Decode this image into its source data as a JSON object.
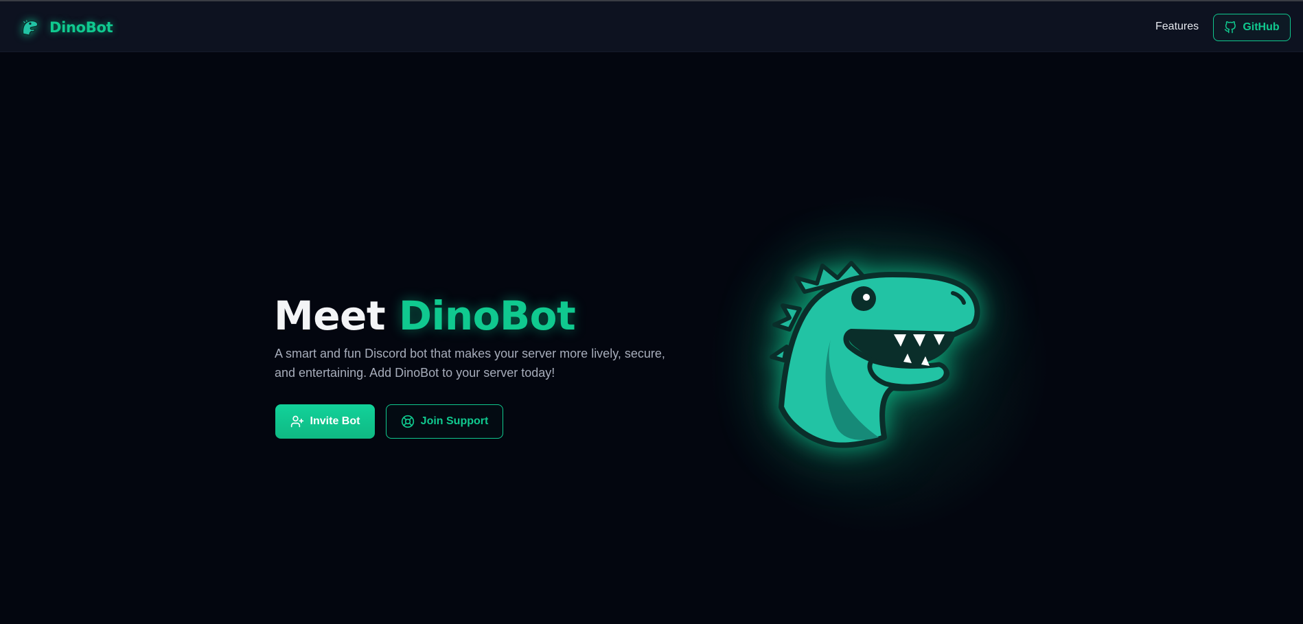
{
  "nav": {
    "brand": "DinoBot",
    "brand_logo_icon": "dino-logo-icon",
    "features_link": "Features",
    "github_label": "GitHub",
    "github_icon": "github-icon"
  },
  "hero": {
    "title_prefix": "Meet ",
    "title_accent": "DinoBot",
    "subtitle": "A smart and fun Discord bot that makes your server more lively, secure, and entertaining. Add DinoBot to your server today!",
    "invite_label": "Invite Bot",
    "invite_icon": "user-plus-icon",
    "support_label": "Join Support",
    "support_icon": "lifebuoy-icon",
    "mascot": "dino-mascot-image"
  },
  "colors": {
    "background": "#03060f",
    "navbar": "#0d1220",
    "accent": "#10c98f",
    "text": "#f3f4f6",
    "muted_text": "#a7adbb"
  }
}
